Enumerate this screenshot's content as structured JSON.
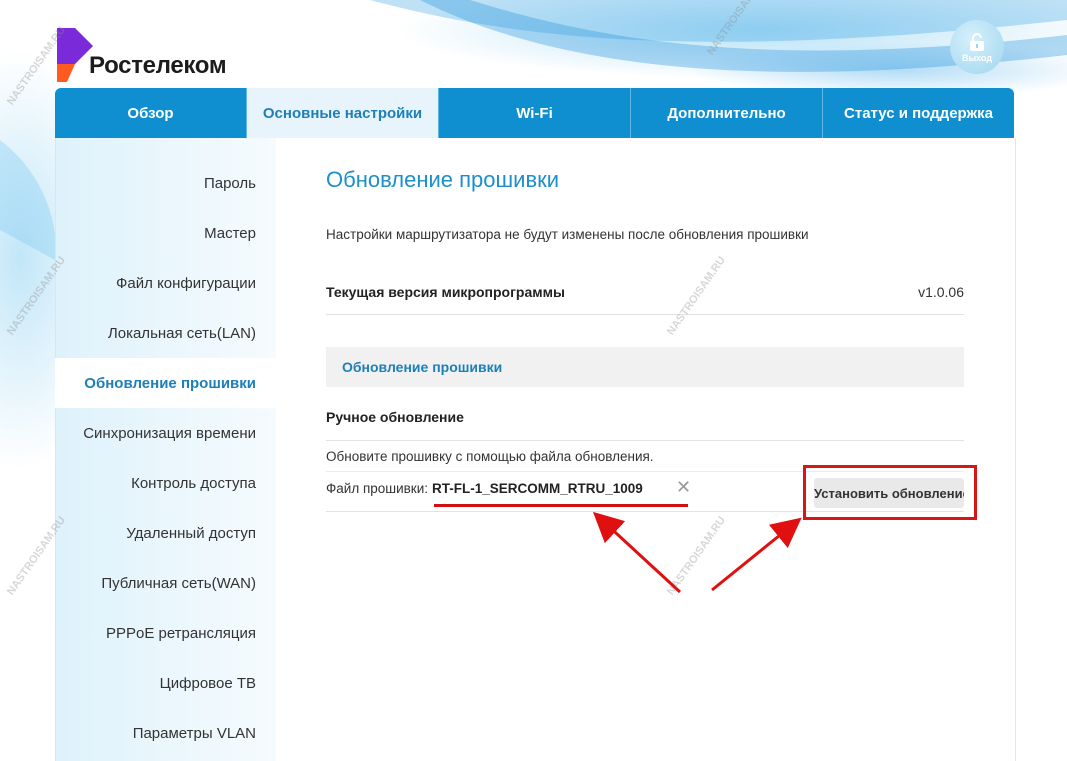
{
  "brand": {
    "name": "Ростелеком",
    "accent": "#0f8fd0",
    "logo_purple": "#7a2ad8",
    "logo_orange": "#ff5a1f"
  },
  "header": {
    "exit_label": "Выход",
    "exit_icon": "unlock-icon"
  },
  "tabs": [
    {
      "label": "Обзор",
      "active": false
    },
    {
      "label": "Основные настройки",
      "active": true
    },
    {
      "label": "Wi-Fi",
      "active": false
    },
    {
      "label": "Дополнительно",
      "active": false
    },
    {
      "label": "Статус и поддержка",
      "active": false
    }
  ],
  "sidebar": {
    "items": [
      {
        "label": "Пароль"
      },
      {
        "label": "Мастер"
      },
      {
        "label": "Файл конфигурации"
      },
      {
        "label": "Локальная сеть(LAN)"
      },
      {
        "label": "Обновление прошивки",
        "active": true
      },
      {
        "label": "Синхронизация времени"
      },
      {
        "label": "Контроль доступа"
      },
      {
        "label": "Удаленный доступ"
      },
      {
        "label": "Публичная сеть(WAN)"
      },
      {
        "label": "PPPoE ретрансляция"
      },
      {
        "label": "Цифровое ТВ"
      },
      {
        "label": "Параметры VLAN"
      }
    ]
  },
  "main": {
    "title": "Обновление прошивки",
    "note": "Настройки маршрутизатора не будут изменены после обновления прошивки",
    "current_version_label": "Текущая версия микропрограммы",
    "current_version_value": "v1.0.06",
    "section_title": "Обновление прошивки",
    "manual_title": "Ручное обновление",
    "hint": "Обновите прошивку с помощью файла обновления.",
    "file_label": "Файл прошивки:",
    "file_name": "RT-FL-1_SERCOMM_RTRU_1009",
    "clear_glyph": "✕",
    "install_button": "Установить обновление"
  },
  "watermark": "NASTROISAM.RU"
}
